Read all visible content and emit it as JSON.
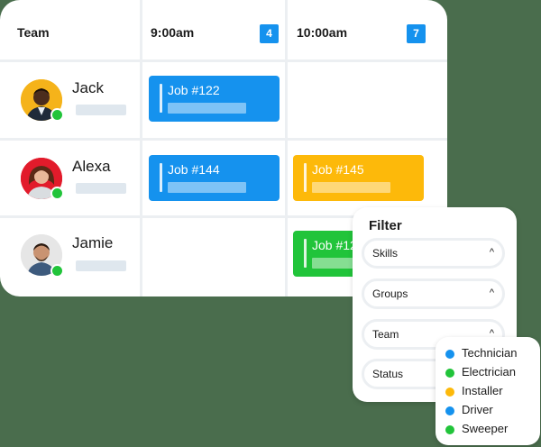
{
  "schedule": {
    "team_header": "Team",
    "columns": [
      {
        "time": "9:00am",
        "count": "4"
      },
      {
        "time": "10:00am",
        "count": "7"
      }
    ],
    "rows": [
      {
        "name": "Jack",
        "jobs": [
          "Job #122"
        ]
      },
      {
        "name": "Alexa",
        "jobs": [
          "Job #144",
          "Job #145"
        ]
      },
      {
        "name": "Jamie",
        "jobs": [
          "Job #12"
        ]
      }
    ]
  },
  "filter": {
    "title": "Filter",
    "groups": [
      "Skills",
      "Groups",
      "Team",
      "Status"
    ]
  },
  "dropdown": {
    "options": [
      {
        "label": "Technician",
        "color": "#1592ee"
      },
      {
        "label": "Electrician",
        "color": "#21c43a"
      },
      {
        "label": "Installer",
        "color": "#fdb90a"
      },
      {
        "label": "Driver",
        "color": "#1592ee"
      },
      {
        "label": "Sweeper",
        "color": "#21c43a"
      }
    ]
  },
  "colors": {
    "blue": "#1592ee",
    "yellow": "#fdb90a",
    "green": "#21c43a",
    "background": "#4a6d4d"
  },
  "icons": [
    "avatar-jack",
    "avatar-alexa",
    "avatar-jamie",
    "online-status-icon",
    "chevron-up-icon"
  ]
}
